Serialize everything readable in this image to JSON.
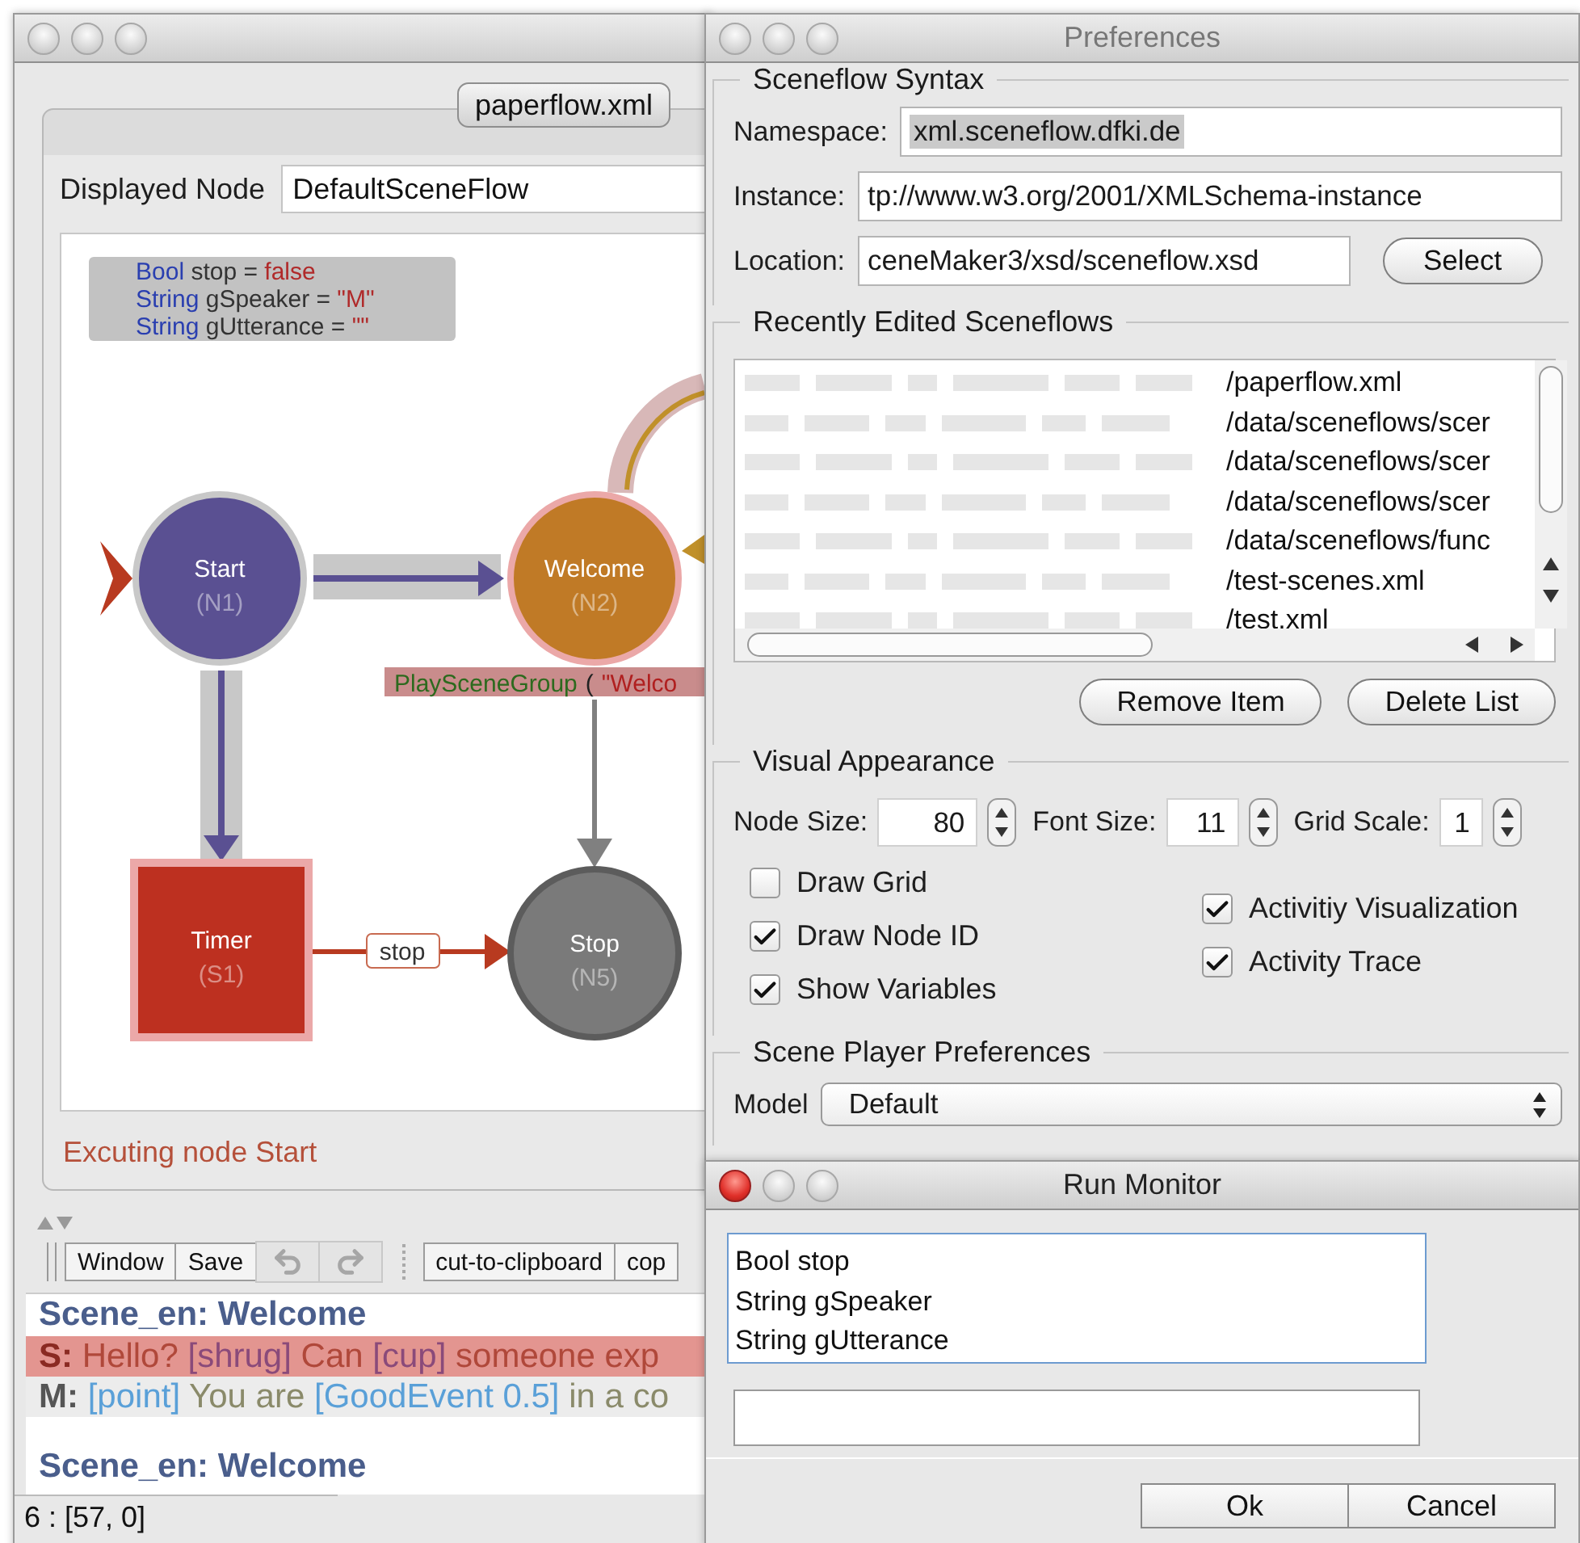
{
  "editor": {
    "active": false,
    "tab": {
      "label": "paperflow.xml",
      "selected": true
    },
    "displayed_node": {
      "label": "Displayed Node",
      "value": "DefaultSceneFlow"
    },
    "variables": [
      {
        "type": "Bool",
        "name": "stop =",
        "value": "false"
      },
      {
        "type": "String",
        "name": "gSpeaker =",
        "value": "\"M\""
      },
      {
        "type": "String",
        "name": "gUtterance =",
        "value": "\"\""
      }
    ],
    "nodes": [
      {
        "kind": "circle",
        "label": "Start",
        "id": "(N1)",
        "color": "#5a5092",
        "active": false
      },
      {
        "kind": "circle",
        "label": "Welcome",
        "id": "(N2)",
        "color": "#c07a26",
        "active": true
      },
      {
        "kind": "square",
        "label": "Timer",
        "id": "(S1)",
        "color": "#bd3020",
        "active": true
      },
      {
        "kind": "circle",
        "label": "Stop",
        "id": "(N5)",
        "color": "#7a7a7a",
        "active": false
      }
    ],
    "edges": [
      {
        "kind": "active"
      },
      {
        "kind": "active"
      },
      {
        "kind": "plain"
      },
      {
        "kind": "conditional",
        "label": "stop"
      },
      {
        "kind": "loop"
      }
    ],
    "command": [
      {
        "kind": "name",
        "text": "PlaySceneGroup"
      },
      {
        "kind": "punct",
        "text": "("
      },
      {
        "kind": "string",
        "text": "\"Welco"
      }
    ],
    "status": "Excuting node Start",
    "toolbar": [
      {
        "kind": "text",
        "label": "Window"
      },
      {
        "kind": "text",
        "label": "Save"
      },
      {
        "kind": "undo",
        "disabled": true
      },
      {
        "kind": "redo",
        "disabled": true
      },
      {
        "kind": "separator"
      },
      {
        "kind": "text",
        "label": "cut-to-clipboard"
      },
      {
        "kind": "text",
        "label": "cop"
      }
    ],
    "transcript": [
      {
        "kind": "heading",
        "text": "Scene_en: Welcome"
      },
      {
        "kind": "line",
        "speaker": "S:",
        "highlighted": true,
        "segments": [
          {
            "kind": "text",
            "text": "Hello?"
          },
          {
            "kind": "gesture",
            "text": "[shrug]"
          },
          {
            "kind": "text",
            "text": "Can"
          },
          {
            "kind": "gesture",
            "text": "[cup]"
          },
          {
            "kind": "text",
            "text": "someone exp"
          }
        ]
      },
      {
        "kind": "line",
        "speaker": "M:",
        "highlighted": false,
        "segments": [
          {
            "kind": "gesture",
            "text": "[point]"
          },
          {
            "kind": "text",
            "text": "You are"
          },
          {
            "kind": "gesture",
            "text": "[GoodEvent 0.5]"
          },
          {
            "kind": "text",
            "text": "in a co"
          }
        ]
      },
      {
        "kind": "blank"
      },
      {
        "kind": "heading",
        "text": "Scene_en: Welcome"
      }
    ],
    "position": "6 : [57, 0]"
  },
  "preferences": {
    "active": false,
    "title": "Preferences",
    "syntax": {
      "title": "Sceneflow Syntax",
      "namespace": {
        "label": "Namespace:",
        "value": "xml.sceneflow.dfki.de",
        "value_selected": true
      },
      "instance": {
        "label": "Instance:",
        "value": "tp://www.w3.org/2001/XMLSchema-instance"
      },
      "location": {
        "label": "Location:",
        "value": "ceneMaker3/xsd/sceneflow.xsd",
        "button": "Select"
      }
    },
    "recent": {
      "title": "Recently Edited Sceneflows",
      "items": [
        "/paperflow.xml",
        "/data/sceneflows/scer",
        "/data/sceneflows/scer",
        "/data/sceneflows/scer",
        "/data/sceneflows/func",
        "/test-scenes.xml",
        "/test.xml"
      ],
      "buttons": [
        "Remove Item",
        "Delete List"
      ]
    },
    "visual": {
      "title": "Visual Appearance",
      "spinners": [
        {
          "label": "Node Size:",
          "value": "80"
        },
        {
          "label": "Font Size:",
          "value": "11"
        },
        {
          "label": "Grid Scale:",
          "value": "1"
        }
      ],
      "left": [
        {
          "label": "Draw Grid",
          "checked": false
        },
        {
          "label": "Draw Node ID",
          "checked": true
        },
        {
          "label": "Show Variables",
          "checked": true
        }
      ],
      "right": [
        {
          "label": "Activitiy Visualization",
          "checked": true
        },
        {
          "label": "Activity Trace",
          "checked": true
        }
      ]
    },
    "player": {
      "title": "Scene Player Preferences",
      "model_label": "Model",
      "model_value": "Default"
    }
  },
  "run_monitor": {
    "active": true,
    "title": "Run Monitor",
    "variables": [
      "Bool stop",
      "String gSpeaker",
      "String gUtterance"
    ],
    "buttons": [
      "Ok",
      "Cancel"
    ]
  }
}
